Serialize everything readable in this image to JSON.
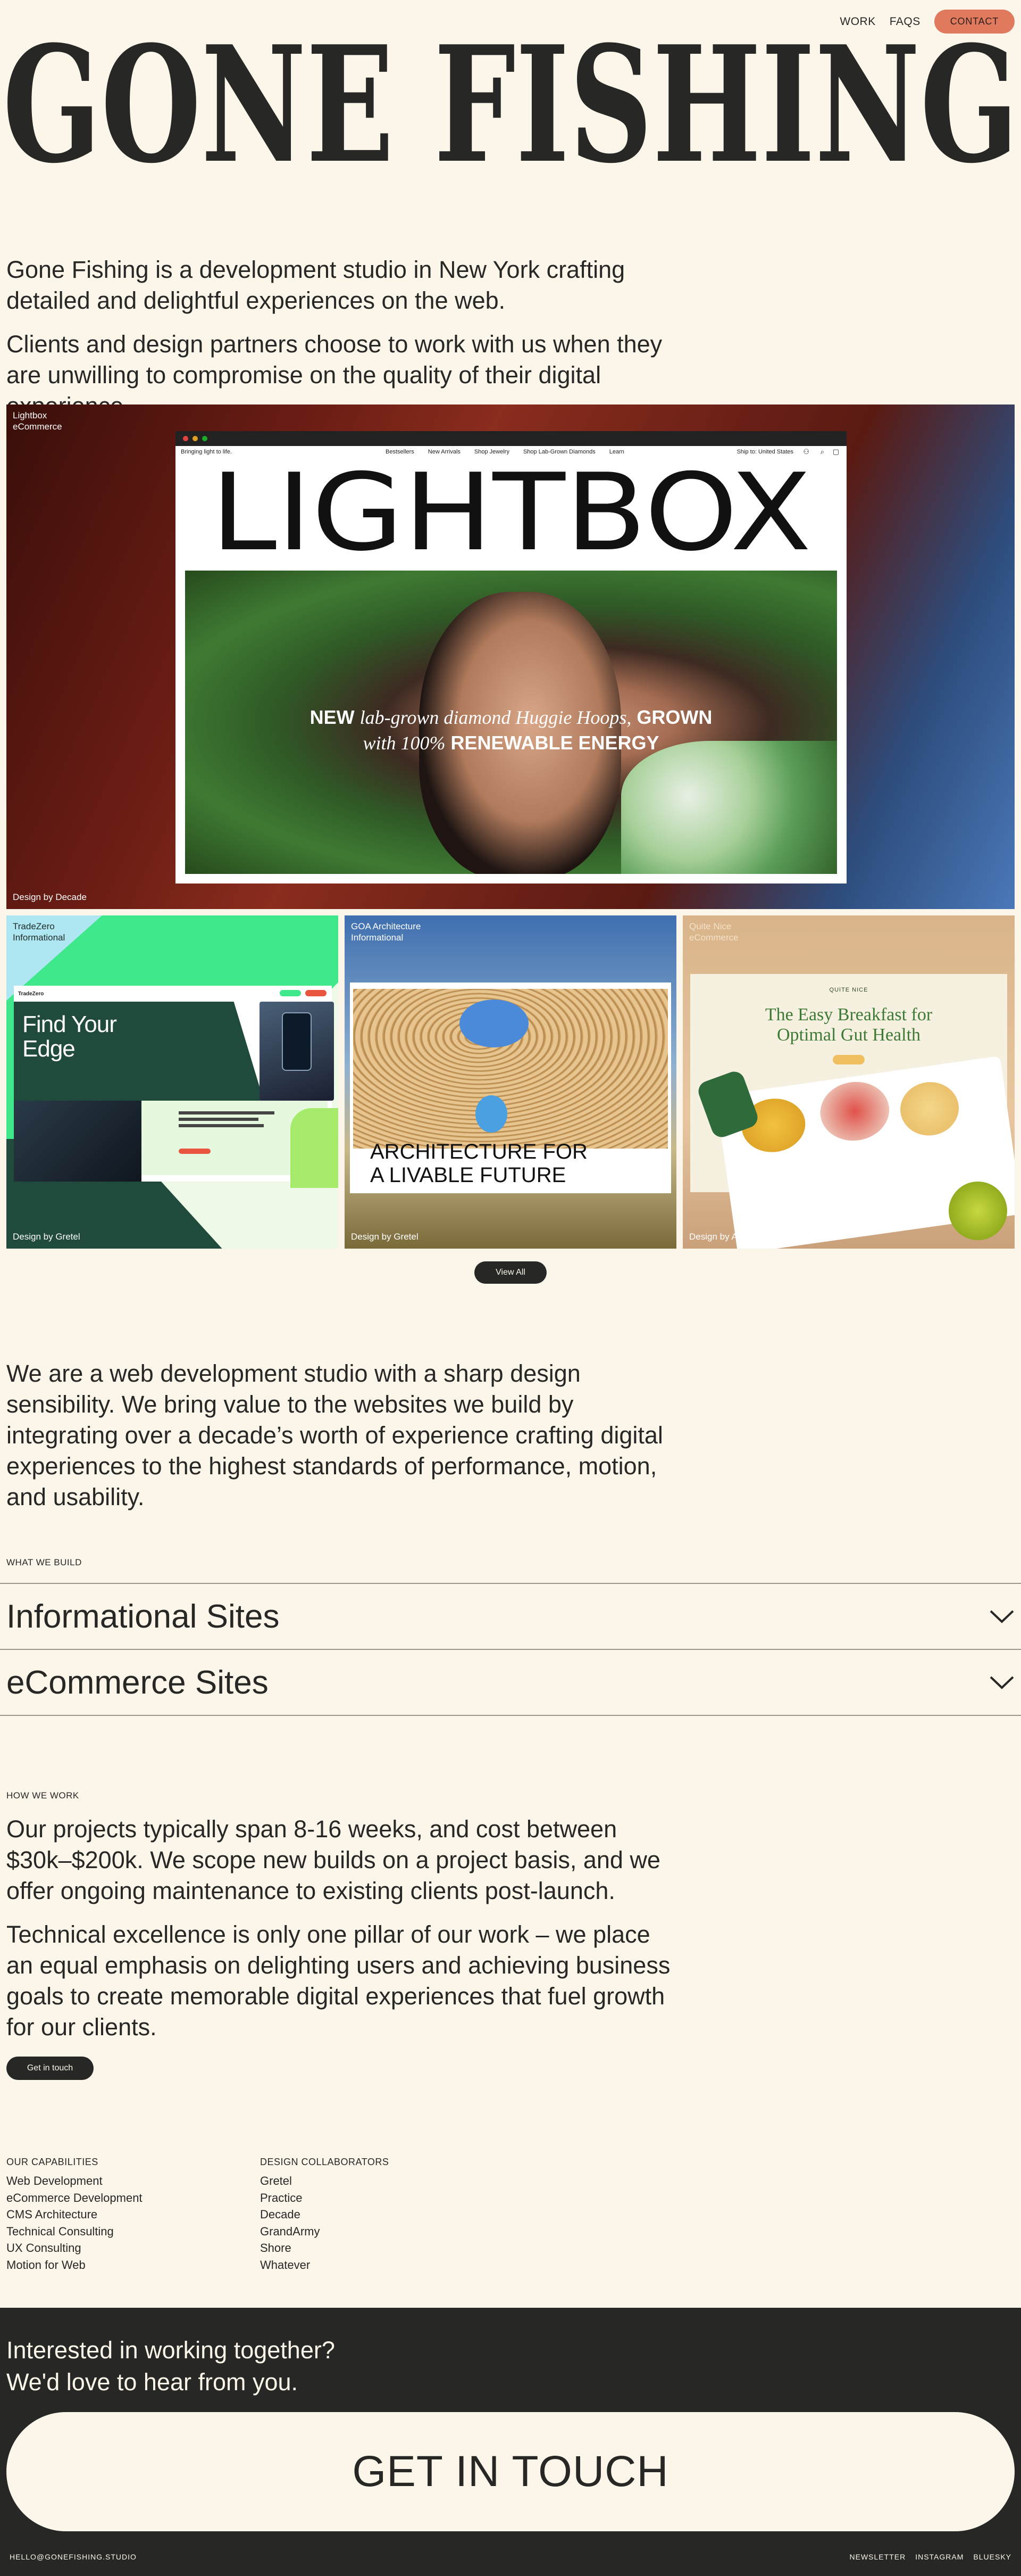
{
  "nav": {
    "work": "WORK",
    "faqs": "FAQS",
    "contact": "CONTACT"
  },
  "brand": {
    "title": "GONE FISHING"
  },
  "intro": {
    "p1": "Gone Fishing is a development studio in New York crafting detailed and delightful experiences on the web.",
    "p2": "Clients and design partners choose to work with us when they are unwilling to compromise on the quality of their digital experience."
  },
  "projects": [
    {
      "name": "Lightbox",
      "type": "eCommerce",
      "credit": "Design by Decade",
      "screen": {
        "nav_left": "Bringing light to life.",
        "nav_links": [
          "Bestsellers",
          "New Arrivals",
          "Shop Jewelry",
          "Shop Lab-Grown Diamonds",
          "Learn"
        ],
        "nav_right": "Ship to: United States",
        "logo": "LIGHTBOX",
        "hero_line1_a": "NEW",
        "hero_line1_b": "lab-grown diamond Huggie Hoops,",
        "hero_line1_c": "GROWN",
        "hero_line2_a": "with 100%",
        "hero_line2_b": "RENEWABLE ENERGY"
      }
    },
    {
      "name": "TradeZero",
      "type": "Informational",
      "credit": "Design by Gretel",
      "screen": {
        "headline": "Find Your Edge",
        "brand": "TradeZero"
      }
    },
    {
      "name": "GOA Architecture",
      "type": "Informational",
      "credit": "Design by Gretel",
      "screen": {
        "headline": "ARCHITECTURE FOR A LIVABLE FUTURE"
      }
    },
    {
      "name": "Quite Nice",
      "type": "eCommerce",
      "credit": "Design by Auda Brenner",
      "screen": {
        "brand": "QUITE NICE",
        "headline": "The Easy Breakfast for Optimal Gut Health"
      }
    }
  ],
  "view_all": "View All",
  "about": "We are a web development studio with a sharp design sensibility. We bring value to the websites we build by integrating over a decade’s worth of experience crafting digital experiences to the highest standards of performance, motion, and usability.",
  "what_we_build": {
    "label": "WHAT WE BUILD",
    "items": [
      "Informational Sites",
      "eCommerce Sites"
    ]
  },
  "how_we_work": {
    "label": "HOW WE WORK",
    "p1": "Our projects typically span 8-16 weeks, and cost between $30k–$200k. We scope new builds on a project basis, and we offer ongoing maintenance to existing clients post-launch.",
    "p2": "Technical excellence is only one pillar of our work – we place an equal emphasis on delighting users and achieving business goals to create memorable digital experiences that fuel growth for our clients.",
    "cta": "Get in touch"
  },
  "capabilities": {
    "label": "OUR CAPABILITIES",
    "items": [
      "Web Development",
      "eCommerce Development",
      "CMS Architecture",
      "Technical Consulting",
      "UX Consulting",
      "Motion for Web"
    ]
  },
  "collaborators": {
    "label": "DESIGN COLLABORATORS",
    "items": [
      "Gretel",
      "Practice",
      "Decade",
      "GrandArmy",
      "Shore",
      "Whatever"
    ]
  },
  "footer": {
    "line1": "Interested in working together?",
    "line2": "We'd love to hear from you.",
    "cta": "GET IN TOUCH",
    "email": "HELLO@GONEFISHING.STUDIO",
    "links": [
      "NEWSLETTER",
      "INSTAGRAM",
      "BLUESKY"
    ]
  },
  "colors": {
    "background": "#fcf6ea",
    "ink": "#272725",
    "accent": "#e07a5f",
    "green": "#3ee88b"
  }
}
